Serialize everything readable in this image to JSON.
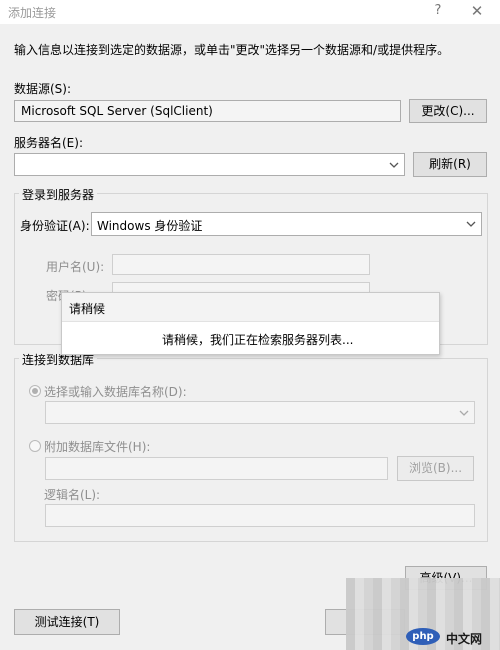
{
  "window": {
    "title": "添加连接",
    "help": "?",
    "close": "✕"
  },
  "intro": "输入信息以连接到选定的数据源，或单击\"更改\"选择另一个数据源和/或提供程序。",
  "datasource": {
    "label": "数据源(S):",
    "value": "Microsoft SQL Server (SqlClient)",
    "change_button": "更改(C)..."
  },
  "server": {
    "label": "服务器名(E):",
    "value": "",
    "refresh_button": "刷新(R)"
  },
  "login_group": {
    "title": "登录到服务器",
    "auth_label": "身份验证(A):",
    "auth_value": "Windows 身份验证",
    "username_label": "用户名(U):",
    "password_label": "密码(P):"
  },
  "db_group": {
    "title": "连接到数据库",
    "select_db_label": "选择或输入数据库名称(D):",
    "attach_label": "附加数据库文件(H):",
    "browse_button": "浏览(B)...",
    "logical_name_label": "逻辑名(L):"
  },
  "advanced_button": "高级(V)...",
  "test_button": "测试连接(T)",
  "wait_popup": {
    "title": "请稍候",
    "message": "请稍候，我们正在检索服务器列表..."
  },
  "watermark": {
    "logo": "php",
    "text": "中文网"
  }
}
